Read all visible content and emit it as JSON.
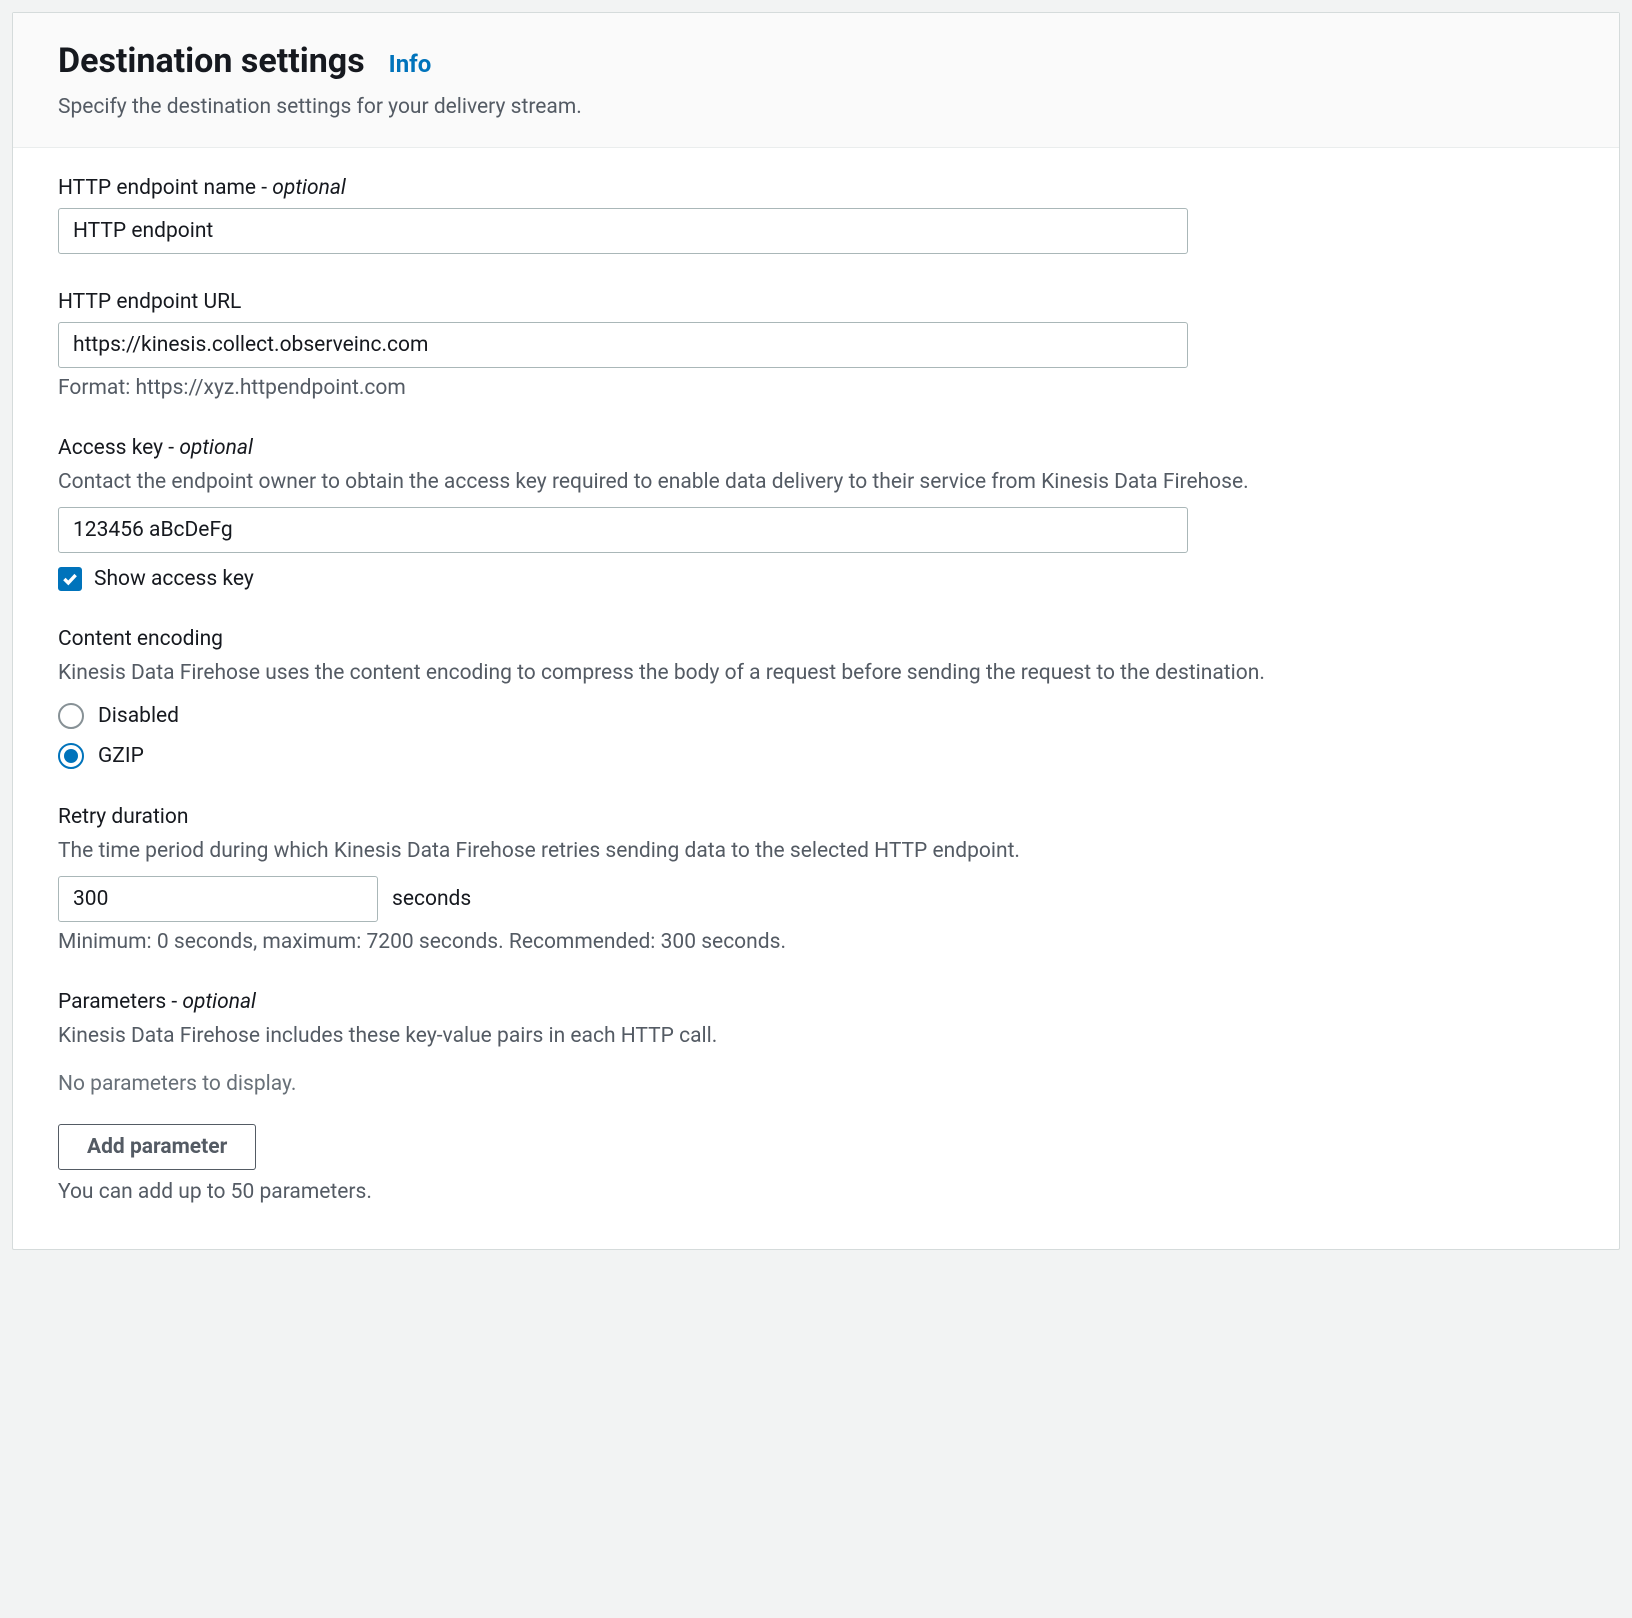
{
  "header": {
    "title": "Destination settings",
    "info_label": "Info",
    "subtitle": "Specify the destination settings for your delivery stream."
  },
  "endpoint_name": {
    "label": "HTTP endpoint name - ",
    "optional": "optional",
    "value": "HTTP endpoint"
  },
  "endpoint_url": {
    "label": "HTTP endpoint URL",
    "value": "https://kinesis.collect.observeinc.com",
    "format_help": "Format: https://xyz.httpendpoint.com"
  },
  "access_key": {
    "label": "Access key - ",
    "optional": "optional",
    "help": "Contact the endpoint owner to obtain the access key required to enable data delivery to their service from Kinesis Data Firehose.",
    "value": "123456 aBcDeFg",
    "show_label": "Show access key"
  },
  "content_encoding": {
    "label": "Content encoding",
    "help": "Kinesis Data Firehose uses the content encoding to compress the body of a request before sending the request to the destination.",
    "options": {
      "disabled": "Disabled",
      "gzip": "GZIP"
    }
  },
  "retry_duration": {
    "label": "Retry duration",
    "help": "The time period during which Kinesis Data Firehose retries sending data to the selected HTTP endpoint.",
    "value": "300",
    "unit": "seconds",
    "constraint": "Minimum: 0 seconds, maximum: 7200 seconds. Recommended: 300 seconds."
  },
  "parameters": {
    "label": "Parameters - ",
    "optional": "optional",
    "help": "Kinesis Data Firehose includes these key-value pairs in each HTTP call.",
    "empty": "No parameters to display.",
    "add_button": "Add parameter",
    "limit_help": "You can add up to 50 parameters."
  }
}
